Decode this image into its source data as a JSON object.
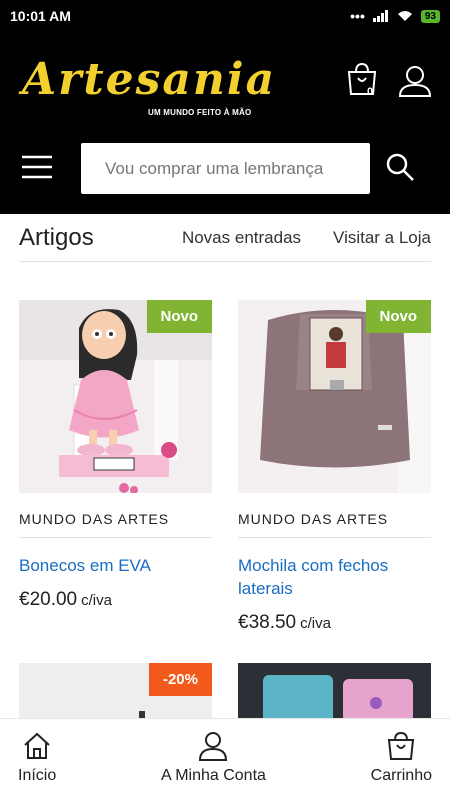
{
  "status": {
    "time": "10:01 AM",
    "battery": "93"
  },
  "header": {
    "logo": "Artesania",
    "logo_sub": "UM MUNDO FEITO À MÃO",
    "cart_count": "0",
    "search_placeholder": "Vou comprar uma lembrança",
    "colors": {
      "background": "#000000",
      "logo": "#f2d02e"
    }
  },
  "tabs": {
    "active": "Artigos",
    "new": "Novas entradas",
    "store": "Visitar a Loja"
  },
  "products": [
    {
      "vendor": "MUNDO DAS ARTES",
      "title": "Bonecos em EVA",
      "price": "€20.00",
      "suffix": "c/iva",
      "badge": "Novo"
    },
    {
      "vendor": "MUNDO DAS ARTES",
      "title": "Mochila com fechos laterais",
      "price": "€38.50",
      "suffix": "c/iva",
      "badge": "Novo"
    },
    {
      "badge": "-20%"
    }
  ],
  "bottom_nav": [
    {
      "label": "Início",
      "icon": "home-icon"
    },
    {
      "label": "A Minha Conta",
      "icon": "user-icon"
    },
    {
      "label": "Carrinho",
      "icon": "cart-icon"
    }
  ],
  "colors": {
    "badge_new": "#82b434",
    "badge_sale": "#f25a1b",
    "link": "#1a6cc4"
  }
}
